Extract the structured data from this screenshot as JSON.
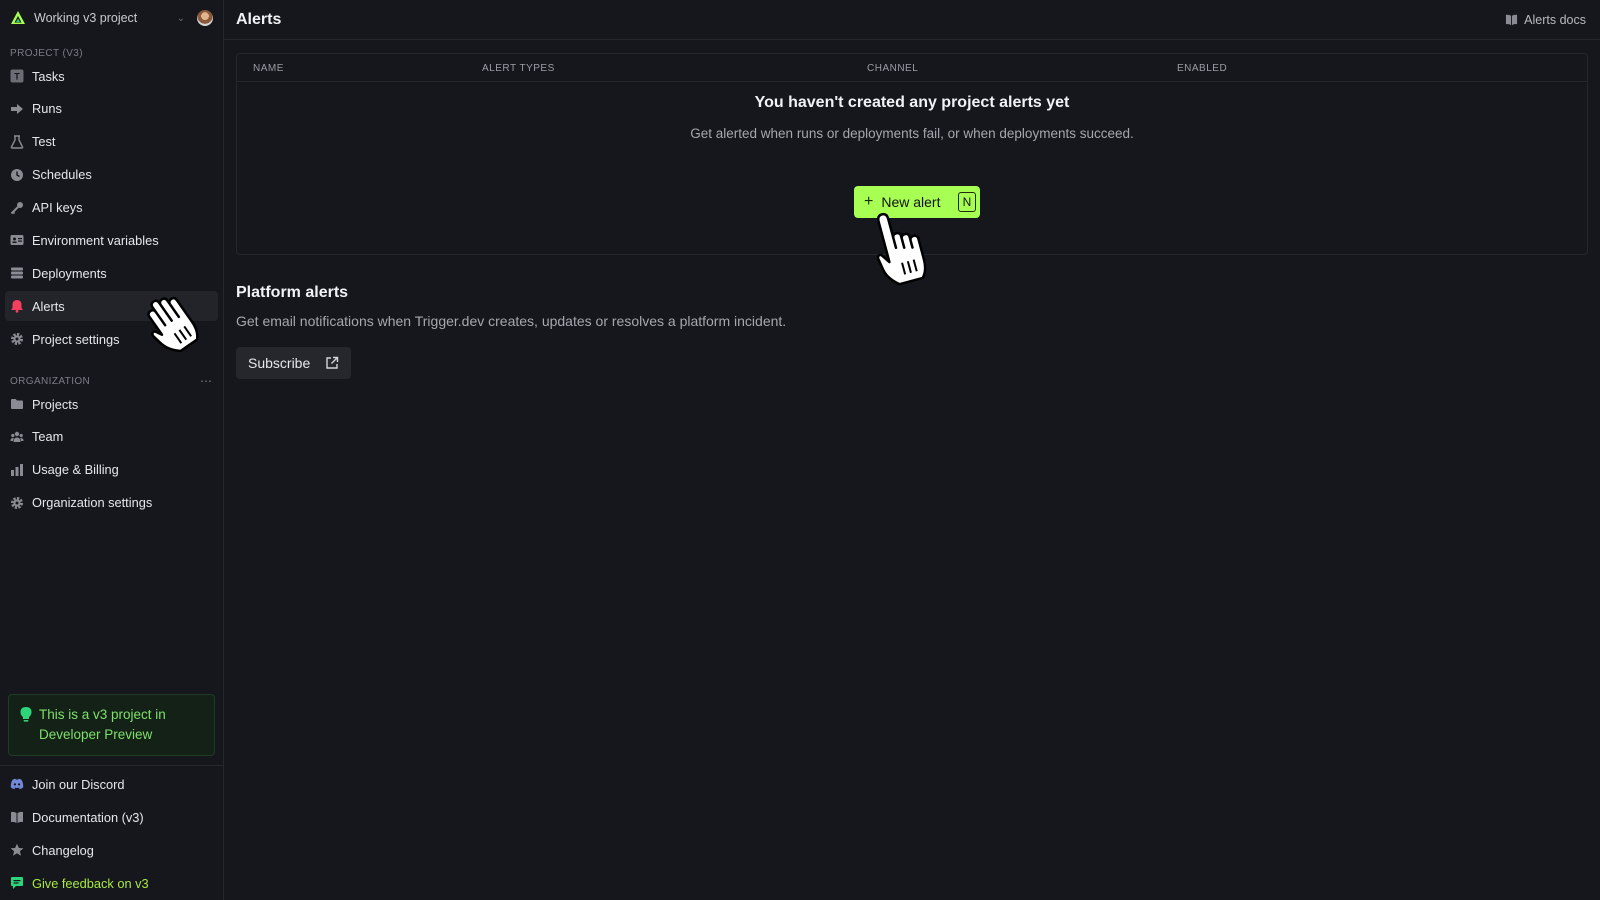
{
  "project": {
    "name": "Working v3 project"
  },
  "sidebar": {
    "project_section": "PROJECT (V3)",
    "project_items": [
      {
        "label": "Tasks",
        "icon": "tasks-icon"
      },
      {
        "label": "Runs",
        "icon": "runs-icon"
      },
      {
        "label": "Test",
        "icon": "beaker-icon"
      },
      {
        "label": "Schedules",
        "icon": "clock-icon"
      },
      {
        "label": "API keys",
        "icon": "key-icon"
      },
      {
        "label": "Environment variables",
        "icon": "env-vars-icon"
      },
      {
        "label": "Deployments",
        "icon": "stack-icon"
      },
      {
        "label": "Alerts",
        "icon": "bell-icon",
        "active": true
      },
      {
        "label": "Project settings",
        "icon": "gear-icon"
      }
    ],
    "org_section": "ORGANIZATION",
    "org_items": [
      {
        "label": "Projects",
        "icon": "folder-icon"
      },
      {
        "label": "Team",
        "icon": "team-icon"
      },
      {
        "label": "Usage & Billing",
        "icon": "bar-chart-icon"
      },
      {
        "label": "Organization settings",
        "icon": "gear-icon"
      }
    ],
    "preview_notice": "This is a v3 project in Developer Preview",
    "bottom_items": [
      {
        "label": "Join our Discord",
        "icon": "discord-icon"
      },
      {
        "label": "Documentation (v3)",
        "icon": "book-icon"
      },
      {
        "label": "Changelog",
        "icon": "star-icon"
      },
      {
        "label": "Give feedback on v3",
        "icon": "chat-icon"
      }
    ]
  },
  "header": {
    "title": "Alerts",
    "docs_label": "Alerts docs"
  },
  "alerts_table": {
    "columns": [
      "NAME",
      "ALERT TYPES",
      "CHANNEL",
      "ENABLED"
    ],
    "empty_title": "You haven't created any project alerts yet",
    "empty_description": "Get alerted when runs or deployments fail, or when deployments succeed.",
    "new_alert_label": "New alert",
    "new_alert_shortcut": "N"
  },
  "platform": {
    "title": "Platform alerts",
    "description": "Get email notifications when Trigger.dev creates, updates or resolves a platform incident.",
    "subscribe_label": "Subscribe"
  },
  "colors": {
    "accent": "#a8ff53",
    "background": "#16171c",
    "alert_active": "#f43f5e"
  }
}
